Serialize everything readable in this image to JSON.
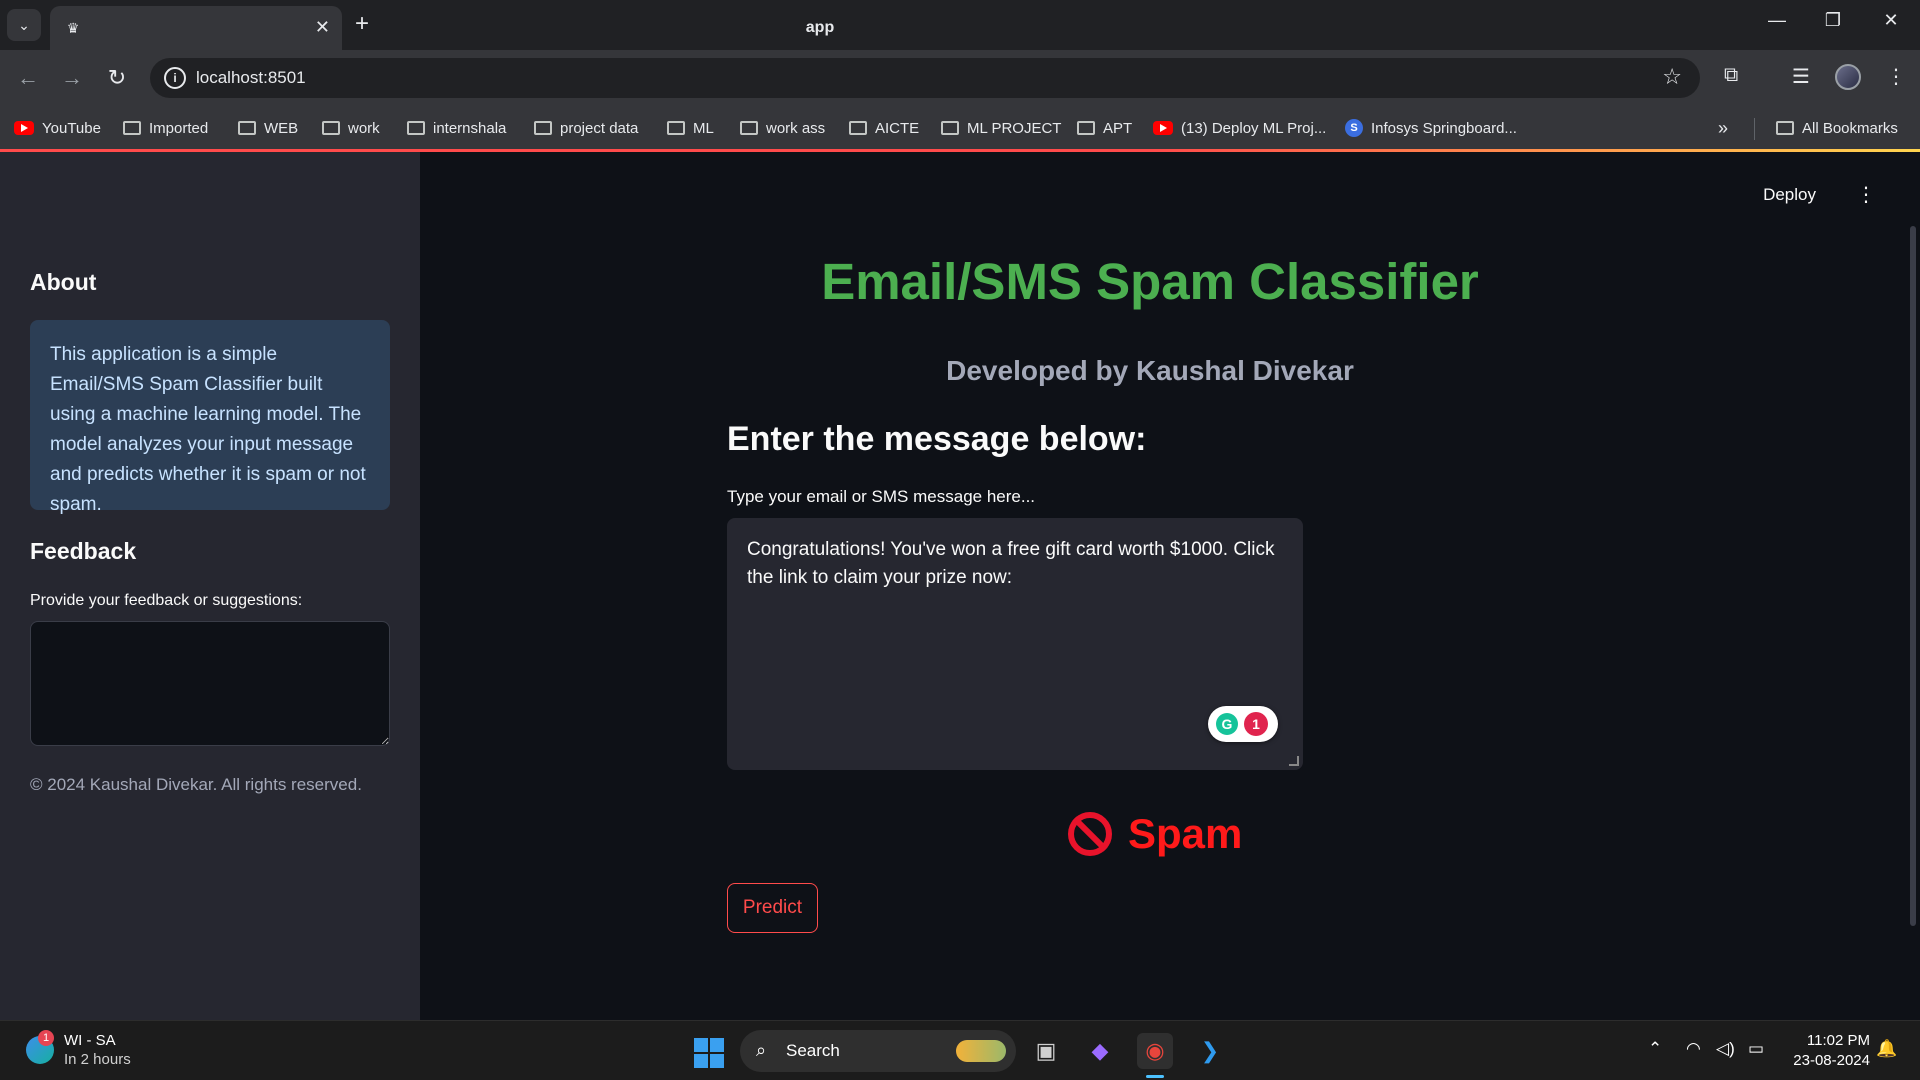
{
  "browser": {
    "tab_title": "app",
    "url": "localhost:8501",
    "bookmarks": [
      {
        "label": "YouTube",
        "icon": "youtube-icon"
      },
      {
        "label": "Imported",
        "icon": "folder-icon"
      },
      {
        "label": "WEB",
        "icon": "folder-icon"
      },
      {
        "label": "work",
        "icon": "folder-icon"
      },
      {
        "label": "internshala",
        "icon": "folder-icon"
      },
      {
        "label": "project data",
        "icon": "folder-icon"
      },
      {
        "label": "ML",
        "icon": "folder-icon"
      },
      {
        "label": "work ass",
        "icon": "folder-icon"
      },
      {
        "label": "AICTE",
        "icon": "folder-icon"
      },
      {
        "label": "ML PROJECT",
        "icon": "folder-icon"
      },
      {
        "label": "APT",
        "icon": "folder-icon"
      },
      {
        "label": "(13) Deploy ML Proj...",
        "icon": "youtube-icon"
      },
      {
        "label": "Infosys Springboard...",
        "icon": "infosys-icon"
      }
    ],
    "all_bookmarks": "All Bookmarks"
  },
  "sidebar": {
    "about_heading": "About",
    "about_text": "This application is a simple Email/SMS Spam Classifier built using a machine learning model. The model analyzes your input message and predicts whether it is spam or not spam.",
    "feedback_heading": "Feedback",
    "feedback_label": "Provide your feedback or suggestions:",
    "feedback_value": "",
    "copyright": "© 2024 Kaushal Divekar. All rights reserved."
  },
  "main": {
    "deploy_label": "Deploy",
    "title": "Email/SMS Spam Classifier",
    "subtitle": "Developed by Kaushal Divekar",
    "section_heading": "Enter the message below:",
    "message_label": "Type your email or SMS message here...",
    "message_value": "Congratulations! You've won a free gift card worth $1000. Click the link to claim your prize now:",
    "grammar_count": "1",
    "result_label": "Spam",
    "predict_label": "Predict",
    "colors": {
      "title": "#4caf50",
      "result": "#ff1a1a",
      "accent": "#ff4b4b"
    }
  },
  "taskbar": {
    "weather_title": "WI - SA",
    "weather_sub": "In 2 hours",
    "weather_badge": "1",
    "search_label": "Search",
    "time": "11:02 PM",
    "date": "23-08-2024"
  }
}
